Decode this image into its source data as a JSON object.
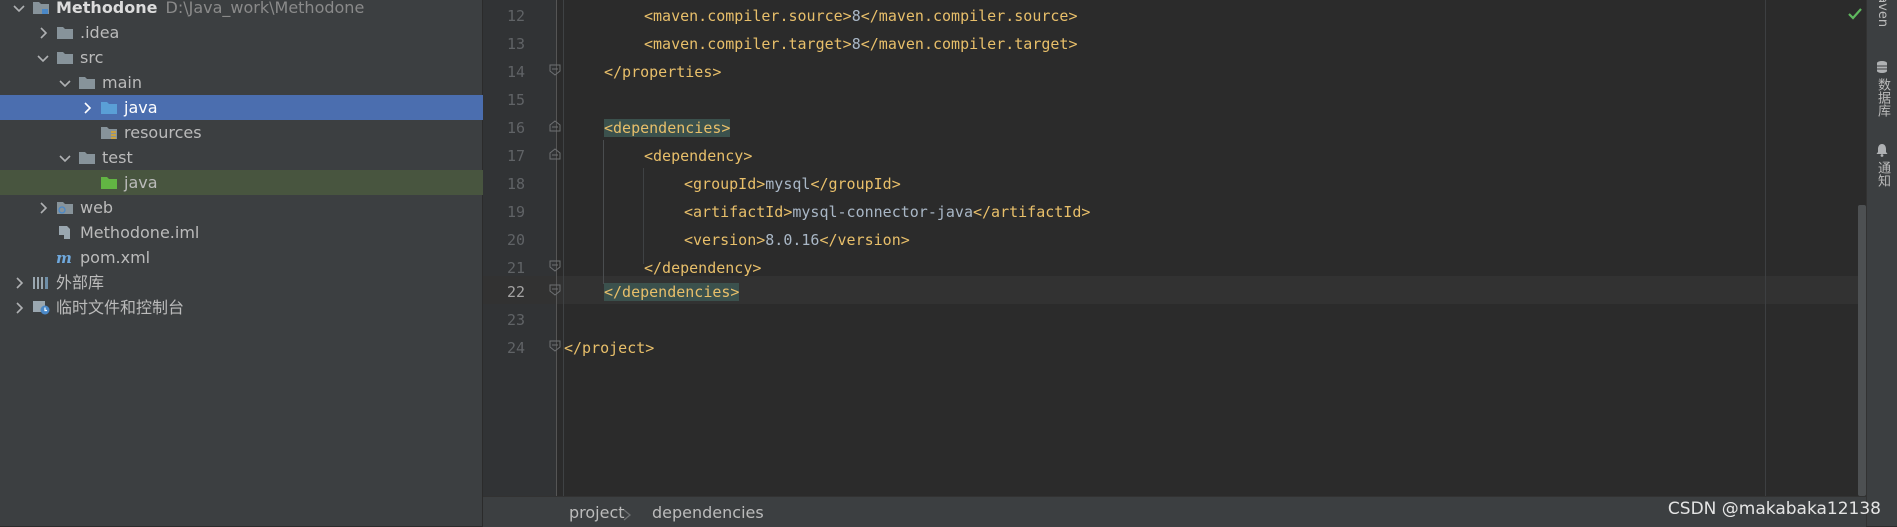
{
  "project_tree": {
    "items": [
      {
        "label": "Methodone",
        "hint": "D:\\Java_work\\Methodone"
      },
      {
        "label": ".idea"
      },
      {
        "label": "src"
      },
      {
        "label": "main"
      },
      {
        "label": "java"
      },
      {
        "label": "resources"
      },
      {
        "label": "test"
      },
      {
        "label": "java"
      },
      {
        "label": "web"
      },
      {
        "label": "Methodone.iml"
      },
      {
        "label": "pom.xml"
      },
      {
        "label": "外部库"
      },
      {
        "label": "临时文件和控制台"
      }
    ]
  },
  "editor": {
    "lines": [
      {
        "num": "12",
        "parts": [
          "<maven.compiler.source>",
          "8",
          "</maven.compiler.source>"
        ]
      },
      {
        "num": "13",
        "parts": [
          "<maven.compiler.target>",
          "8",
          "</maven.compiler.target>"
        ]
      },
      {
        "num": "14",
        "parts": [
          "</properties>"
        ]
      },
      {
        "num": "15",
        "parts": []
      },
      {
        "num": "16",
        "parts": [
          "<dependencies>"
        ]
      },
      {
        "num": "17",
        "parts": [
          "<dependency>"
        ]
      },
      {
        "num": "18",
        "parts": [
          "<groupId>",
          "mysql",
          "</groupId>"
        ]
      },
      {
        "num": "19",
        "parts": [
          "<artifactId>",
          "mysql-connector-java",
          "</artifactId>"
        ]
      },
      {
        "num": "20",
        "parts": [
          "<version>",
          "8.0.16",
          "</version>"
        ]
      },
      {
        "num": "21",
        "parts": [
          "</dependency>"
        ]
      },
      {
        "num": "22",
        "parts": [
          "</dependencies>"
        ]
      },
      {
        "num": "23",
        "parts": []
      },
      {
        "num": "24",
        "parts": [
          "</project>"
        ]
      }
    ]
  },
  "breadcrumb": {
    "items": [
      "project",
      "dependencies"
    ]
  },
  "tool_window_strip": {
    "maven_label": "Maven",
    "database_label": "数据库",
    "notifications_label": "通知"
  },
  "watermark": "CSDN @makabaka12138",
  "colors": {
    "tag": "#e8bf6a",
    "text": "#a9b7c6",
    "selection": "#4b6eaf",
    "test_highlight": "#48553f"
  }
}
